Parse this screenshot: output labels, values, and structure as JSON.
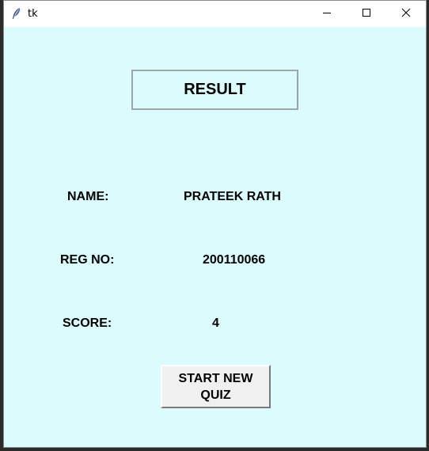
{
  "window": {
    "title": "tk",
    "background_color": "#dcfbfd"
  },
  "titlebar": {
    "app_icon": "feather-icon",
    "minimize_icon": "minimize-icon",
    "maximize_icon": "maximize-icon",
    "close_icon": "close-icon"
  },
  "main": {
    "heading": "RESULT",
    "name_label": "NAME:",
    "name_value": "PRATEEK RATH",
    "reg_label": "REG NO:",
    "reg_value": "200110066",
    "score_label": "SCORE:",
    "score_value": "4",
    "start_button_line1": "START NEW",
    "start_button_line2": "QUIZ"
  }
}
